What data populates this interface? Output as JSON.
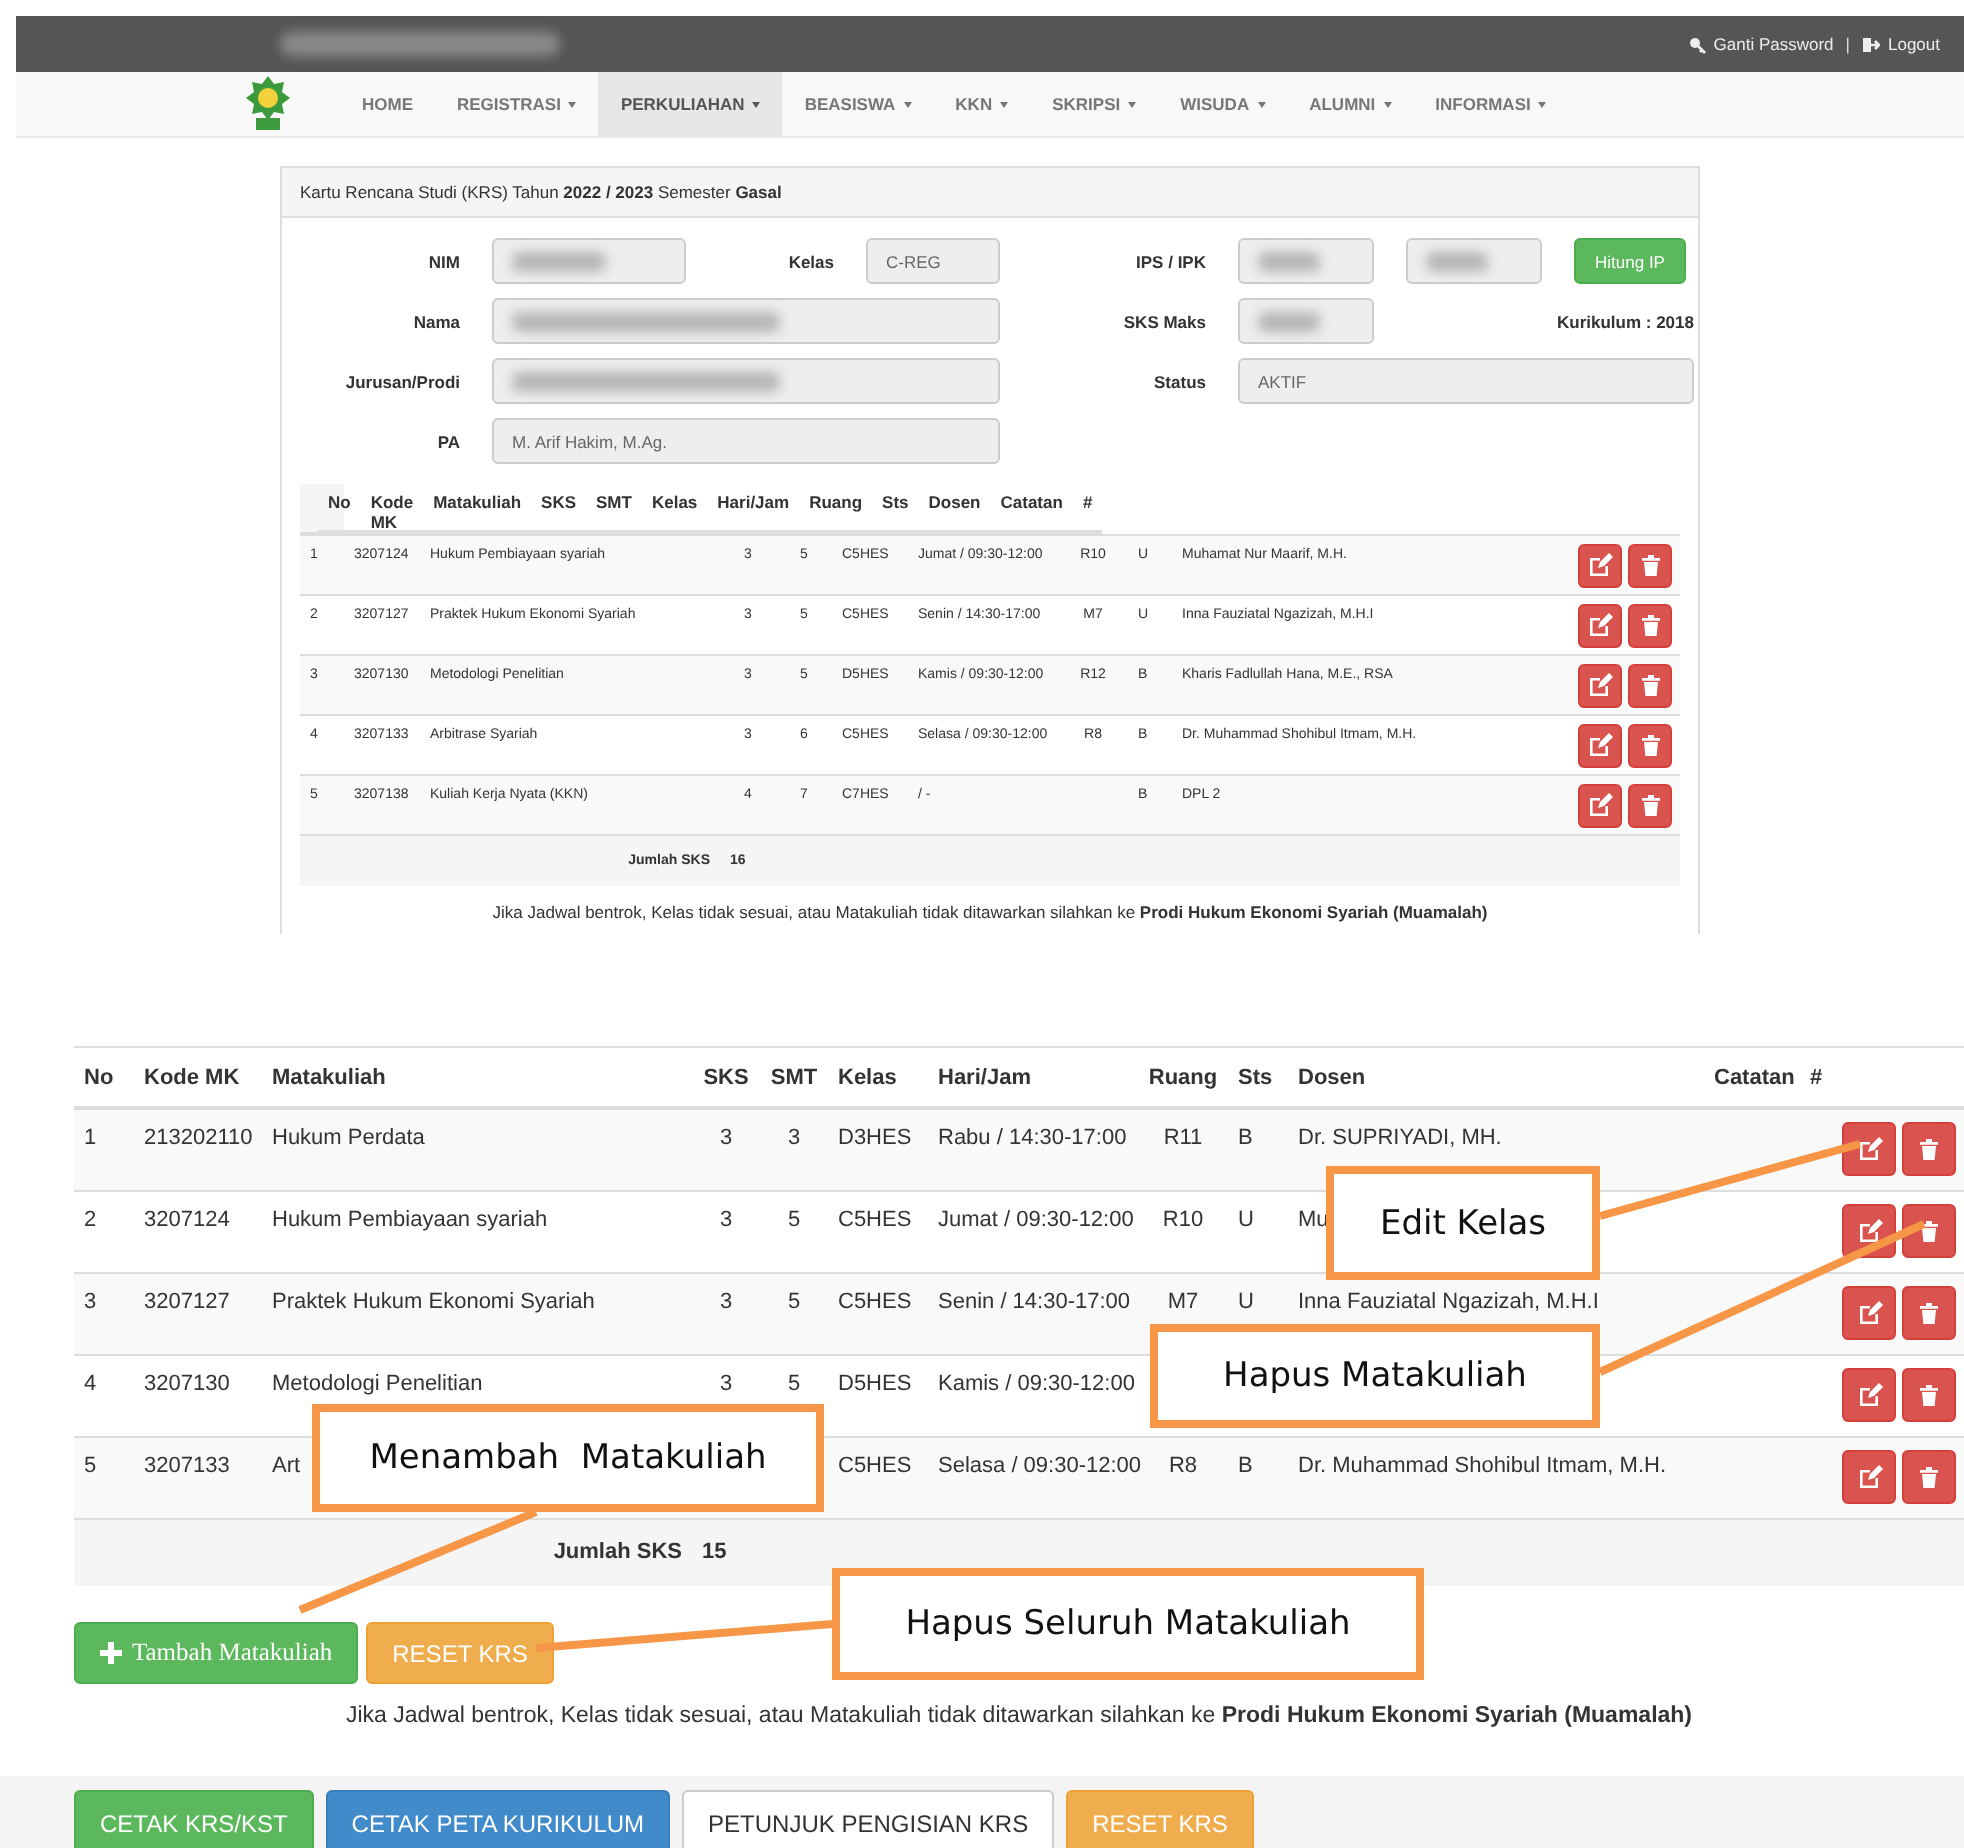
{
  "header": {
    "user_redacted": true,
    "links": [
      "Ganti Password",
      "Logout"
    ],
    "separator": "|"
  },
  "nav": [
    {
      "label": "HOME",
      "dropdown": false,
      "selected": false
    },
    {
      "label": "REGISTRASI",
      "dropdown": true,
      "selected": false
    },
    {
      "label": "PERKULIAHAN",
      "dropdown": true,
      "selected": true
    },
    {
      "label": "BEASISWA",
      "dropdown": true,
      "selected": false
    },
    {
      "label": "KKN",
      "dropdown": true,
      "selected": false
    },
    {
      "label": "SKRIPSI",
      "dropdown": true,
      "selected": false
    },
    {
      "label": "WISUDA",
      "dropdown": true,
      "selected": false
    },
    {
      "label": "ALUMNI",
      "dropdown": true,
      "selected": false
    },
    {
      "label": "INFORMASI",
      "dropdown": true,
      "selected": false
    }
  ],
  "krs_panel": {
    "heading": "Kartu Rencana Studi (KRS) Tahun **2022 / 2023** Semester **Gasal**",
    "form": [
      [
        {
          "kind": "label",
          "text": "NIM"
        },
        {
          "kind": "field",
          "redacted": true
        },
        {
          "kind": "label",
          "text": "Kelas"
        },
        {
          "kind": "field",
          "redacted": false,
          "value": "C-REG"
        },
        {
          "kind": "label",
          "text": "IPS / IPK"
        },
        {
          "kind": "field",
          "redacted": true
        },
        {
          "kind": "field",
          "redacted": true
        },
        {
          "kind": "button",
          "text": "Hitung IP"
        }
      ],
      [
        {
          "kind": "label",
          "text": "Nama"
        },
        {
          "kind": "field",
          "redacted": true
        },
        {
          "kind": "label",
          "text": "SKS Maks"
        },
        {
          "kind": "field",
          "redacted": true
        },
        {
          "kind": "note",
          "text": "Kurikulum : 2018"
        }
      ],
      [
        {
          "kind": "label",
          "text": "Jurusan/Prodi"
        },
        {
          "kind": "field",
          "redacted": true
        },
        {
          "kind": "label",
          "text": "Status"
        },
        {
          "kind": "field",
          "redacted": false,
          "value": "AKTIF"
        }
      ],
      [
        {
          "kind": "label",
          "text": "PA"
        },
        {
          "kind": "field",
          "redacted": false,
          "value": "M. Arif Hakim, M.Ag."
        }
      ]
    ],
    "table": {
      "columns": [
        "No",
        "Kode MK",
        "Matakuliah",
        "SKS",
        "SMT",
        "Kelas",
        "Hari/Jam",
        "Ruang",
        "Sts",
        "Dosen",
        "Catatan",
        "#"
      ],
      "rows": [
        {
          "no": "1",
          "kode": "3207124",
          "matakuliah": "Hukum Pembiayaan syariah",
          "sks": "3",
          "smt": "5",
          "kelas": "C5HES",
          "hari_jam": "Jumat / 09:30-12:00",
          "ruang": "R10",
          "sts": "U",
          "dosen": "Muhamat Nur Maarif, M.H."
        },
        {
          "no": "2",
          "kode": "3207127",
          "matakuliah": "Praktek Hukum Ekonomi Syariah",
          "sks": "3",
          "smt": "5",
          "kelas": "C5HES",
          "hari_jam": "Senin / 14:30-17:00",
          "ruang": "M7",
          "sts": "U",
          "dosen": "Inna Fauziatal Ngazizah, M.H.I"
        },
        {
          "no": "3",
          "kode": "3207130",
          "matakuliah": "Metodologi Penelitian",
          "sks": "3",
          "smt": "5",
          "kelas": "D5HES",
          "hari_jam": "Kamis / 09:30-12:00",
          "ruang": "R12",
          "sts": "B",
          "dosen": "Kharis Fadlullah Hana, M.E., RSA"
        },
        {
          "no": "4",
          "kode": "3207133",
          "matakuliah": "Arbitrase Syariah",
          "sks": "3",
          "smt": "6",
          "kelas": "C5HES",
          "hari_jam": "Selasa / 09:30-12:00",
          "ruang": "R8",
          "sts": "B",
          "dosen": "Dr. Muhammad Shohibul Itmam, M.H."
        },
        {
          "no": "5",
          "kode": "3207138",
          "matakuliah": "Kuliah Kerja Nyata (KKN)",
          "sks": "4",
          "smt": "7",
          "kelas": "C7HES",
          "hari_jam": "/ -",
          "sts": "B",
          "dosen": "DPL 2"
        }
      ],
      "total_label": "Jumlah SKS",
      "total": "16"
    },
    "note": "Jika Jadwal bentrok, Kelas tidak sesuai, atau Matakuliah tidak ditawarkan silahkan ke **Prodi Hukum Ekonomi Syariah (Muamalah)**"
  },
  "krs_edit": {
    "table": {
      "columns": [
        "No",
        "Kode MK",
        "Matakuliah",
        "SKS",
        "SMT",
        "Kelas",
        "Hari/Jam",
        "Ruang",
        "Sts",
        "Dosen",
        "Catatan",
        "#"
      ],
      "rows": [
        {
          "no": "1",
          "kode": "213202110",
          "matakuliah": "Hukum Perdata",
          "sks": "3",
          "smt": "3",
          "kelas": "D3HES",
          "hari_jam": "Rabu / 14:30-17:00",
          "ruang": "R11",
          "sts": "B",
          "dosen": "Dr. SUPRIYADI, MH."
        },
        {
          "no": "2",
          "kode": "3207124",
          "matakuliah": "Hukum Pembiayaan syariah",
          "sks": "3",
          "smt": "5",
          "kelas": "C5HES",
          "hari_jam": "Jumat / 09:30-12:00",
          "ruang": "R10",
          "sts": "U",
          "dosen": "Mu"
        },
        {
          "no": "3",
          "kode": "3207127",
          "matakuliah": "Praktek Hukum Ekonomi Syariah",
          "sks": "3",
          "smt": "5",
          "kelas": "C5HES",
          "hari_jam": "Senin / 14:30-17:00",
          "ruang": "M7",
          "sts": "U",
          "dosen": "Inna Fauziatal Ngazizah, M.H.I"
        },
        {
          "no": "4",
          "kode": "3207130",
          "matakuliah": "Metodologi Penelitian",
          "sks": "3",
          "smt": "5",
          "kelas": "D5HES",
          "hari_jam": "Kamis / 09:30-12:00"
        },
        {
          "no": "5",
          "kode": "3207133",
          "matakuliah": "Art",
          "kelas": "C5HES",
          "hari_jam": "Selasa / 09:30-12:00",
          "ruang": "R8",
          "sts": "B",
          "dosen": "Dr. Muhammad Shohibul Itmam, M.H."
        }
      ],
      "total_label": "Jumlah SKS",
      "total": "15"
    },
    "actions": [
      {
        "label": "Tambah Matakuliah",
        "kind": "success",
        "plus": true
      },
      {
        "label": "RESET KRS",
        "kind": "warning",
        "plus": false
      }
    ],
    "note": "Jika Jadwal bentrok, Kelas tidak sesuai, atau Matakuliah tidak ditawarkan silahkan ke **Prodi Hukum Ekonomi Syariah (Muamalah)**",
    "footer_buttons": [
      {
        "label": "CETAK KRS/KST",
        "kind": "success"
      },
      {
        "label": "CETAK PETA KURIKULUM",
        "kind": "primary"
      },
      {
        "label": "PETUNJUK PENGISIAN KRS",
        "kind": "default"
      },
      {
        "label": "RESET KRS",
        "kind": "warning"
      }
    ]
  },
  "callouts": [
    "Edit Kelas",
    "Hapus Matakuliah",
    "Menambah  Matakuliah",
    "Hapus Seluruh Matakuliah"
  ]
}
